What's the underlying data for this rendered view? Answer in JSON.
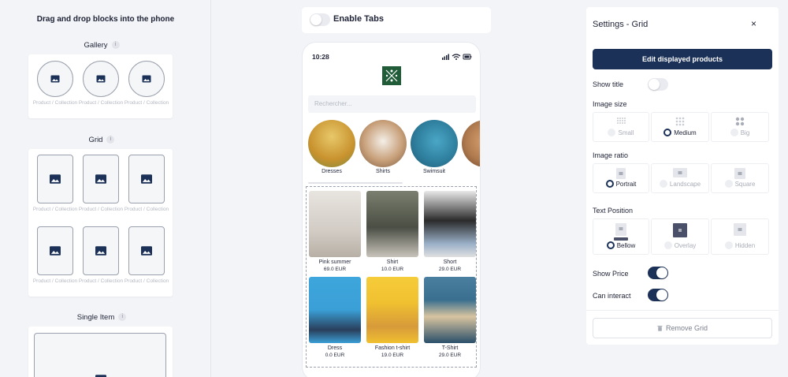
{
  "left": {
    "title": "Drag and drop blocks into the phone",
    "gallery": {
      "label": "Gallery",
      "item_label": "Product / Collection"
    },
    "grid": {
      "label": "Grid",
      "item_label": "Product / Collection"
    },
    "single": {
      "label": "Single Item"
    },
    "info_glyph": "i"
  },
  "tabs_toggle": {
    "label": "Enable Tabs",
    "enabled": false
  },
  "phone": {
    "time": "10:28",
    "search_placeholder": "Rechercher...",
    "categories": [
      {
        "label": "Dresses",
        "color": "#d9a843"
      },
      {
        "label": "Shirts",
        "color": "#c9a07a"
      },
      {
        "label": "Swimsuit",
        "color": "#2f7f9e"
      },
      {
        "label": "Mo",
        "color": "#b07a4f"
      }
    ],
    "products": [
      {
        "name": "Pink summer",
        "price": "69.0 EUR",
        "color": "#d8d2cc"
      },
      {
        "name": "Shirt",
        "price": "10.0 EUR",
        "color": "#5a5e55"
      },
      {
        "name": "Short",
        "price": "29.0 EUR",
        "color": "#cfcfcf"
      },
      {
        "name": "Dress",
        "price": "0.0 EUR",
        "color": "#3a9fd6"
      },
      {
        "name": "Fashion t-shirt",
        "price": "19.0 EUR",
        "color": "#f0c030"
      },
      {
        "name": "T-Shirt",
        "price": "29.0 EUR",
        "color": "#3a6f8f"
      }
    ]
  },
  "settings": {
    "title": "Settings - Grid",
    "close_glyph": "×",
    "edit_label": "Edit displayed products",
    "show_title": {
      "label": "Show title",
      "enabled": false
    },
    "image_size": {
      "label": "Image size",
      "options": [
        "Small",
        "Medium",
        "Big"
      ],
      "selected": "Medium"
    },
    "image_ratio": {
      "label": "Image ratio",
      "options": [
        "Portrait",
        "Landscape",
        "Square"
      ],
      "selected": "Portrait"
    },
    "text_position": {
      "label": "Text Position",
      "options": [
        "Bellow",
        "Overlay",
        "Hidden"
      ],
      "selected": "Bellow"
    },
    "show_price": {
      "label": "Show Price",
      "enabled": true
    },
    "can_interact": {
      "label": "Can interact",
      "enabled": true
    },
    "remove_label": "Remove Grid"
  },
  "colors": {
    "primary": "#1b3157",
    "background": "#f3f4f7",
    "logo": "#1f5c37"
  }
}
